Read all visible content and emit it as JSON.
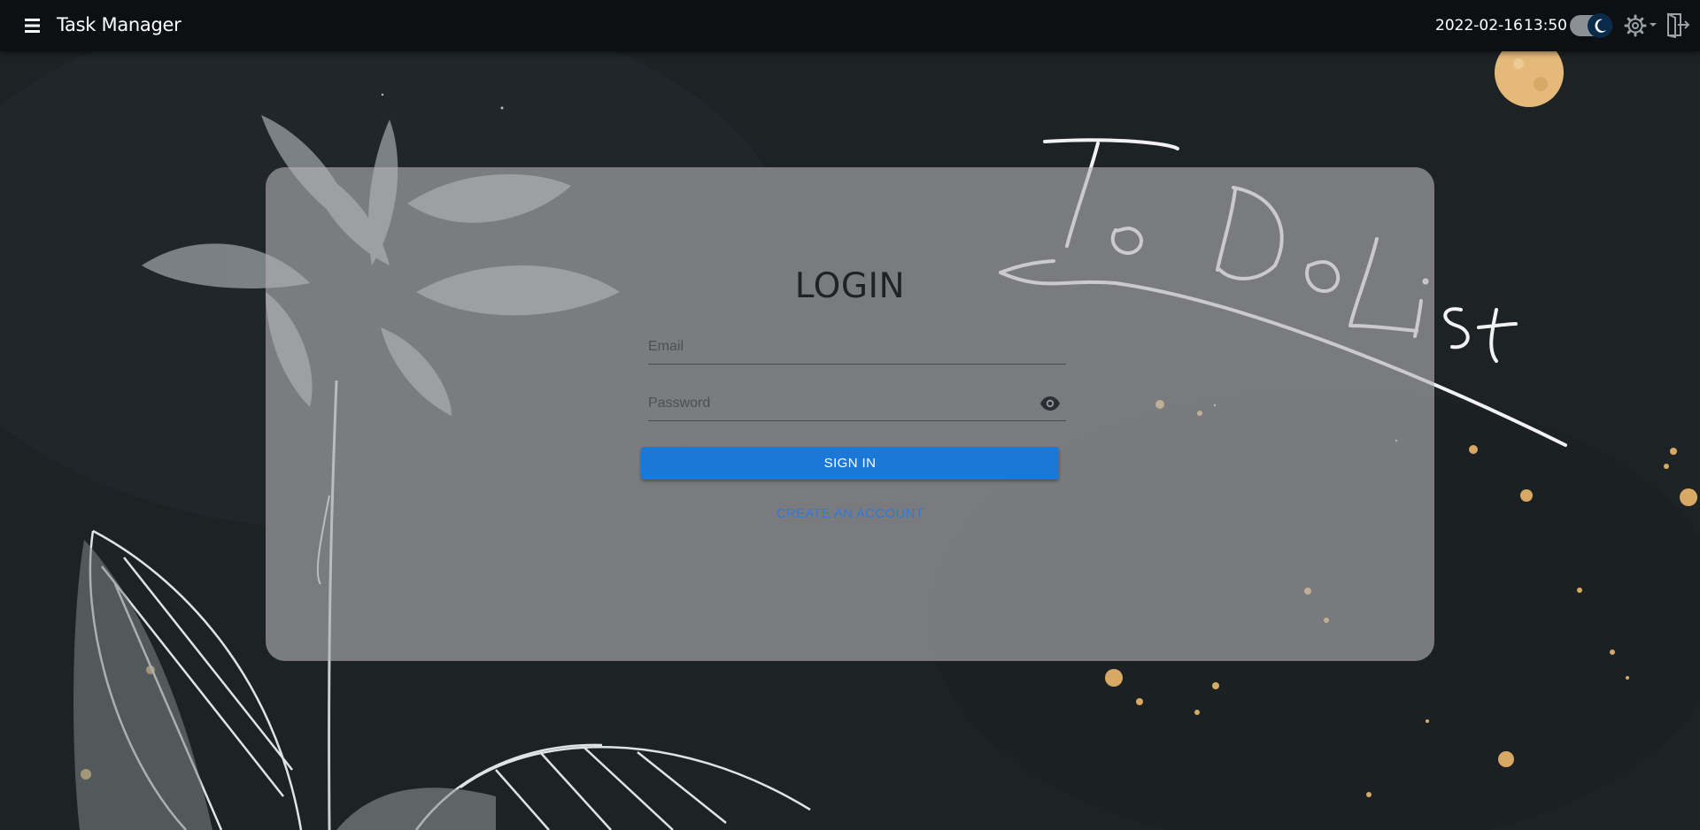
{
  "topbar": {
    "menu_icon": "hamburger-menu-icon",
    "title": "Task Manager",
    "date": "2022-02-16",
    "time": "13:50",
    "theme_toggle_icon": "moon-icon",
    "settings_icon": "gear-icon",
    "logout_icon": "logout-icon"
  },
  "login": {
    "title": "LOGIN",
    "email_placeholder": "Email",
    "email_value": "",
    "password_placeholder": "Password",
    "password_value": "",
    "toggle_visibility_icon": "eye-icon",
    "signin_label": "SIGN IN",
    "create_account_label": "CREATE AN ACCOUNT"
  },
  "background": {
    "handwritten_title": "To Do List"
  },
  "colors": {
    "topbar": "#0c1013",
    "background": "#1e2426",
    "card": "#b2b2b4",
    "primary_button": "#1c78d6",
    "link": "#3279d8"
  }
}
